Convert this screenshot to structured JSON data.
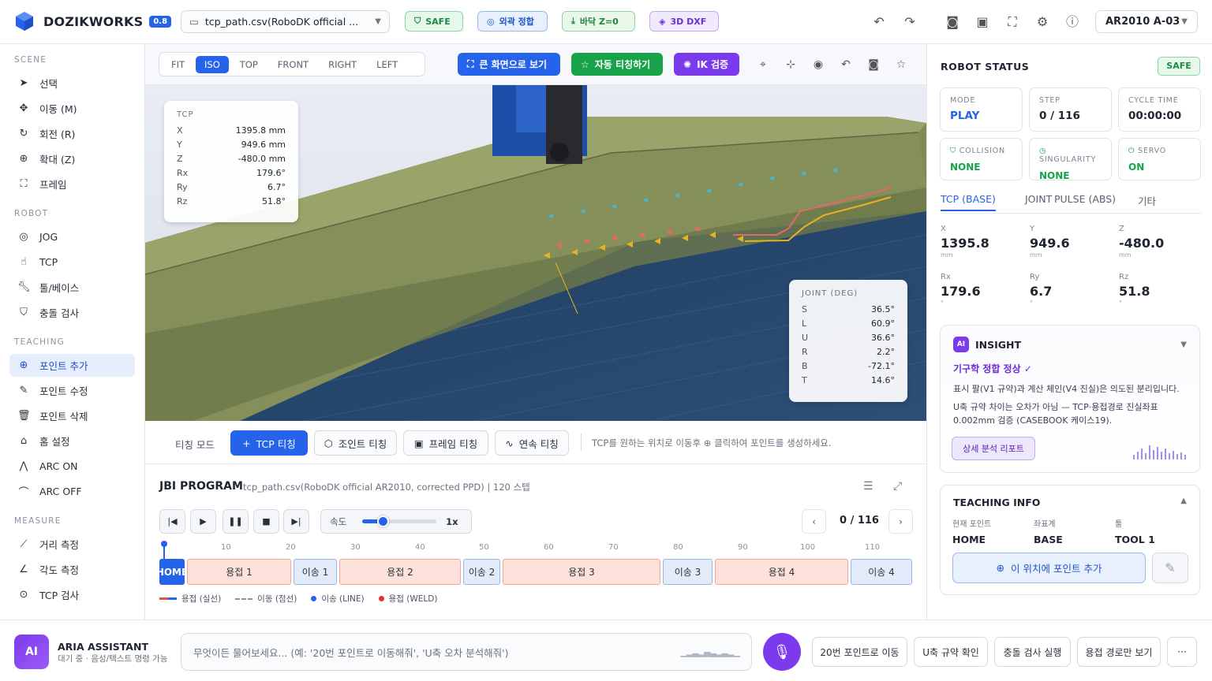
{
  "header": {
    "app_name": "DOZIKWORKS",
    "version": "0.8",
    "file": "tcp_path.csv(RoboDK official ...",
    "badges": {
      "safe": "SAFE",
      "ext": "외곽 정합",
      "floor": "바닥 Z=0",
      "dxf": "3D DXF"
    },
    "robot": "AR2010 A-03"
  },
  "sidebar": {
    "scene_title": "SCENE",
    "scene": [
      "선택",
      "이동 (M)",
      "회전 (R)",
      "확대 (Z)",
      "프레임"
    ],
    "robot_title": "ROBOT",
    "robot": [
      "JOG",
      "TCP",
      "툴/베이스",
      "충돌 검사"
    ],
    "teaching_title": "TEACHING",
    "teaching": [
      "포인트 추가",
      "포인트 수정",
      "포인트 삭제",
      "홈 설정",
      "ARC ON",
      "ARC OFF"
    ],
    "measure_title": "MEASURE",
    "measure": [
      "거리 측정",
      "각도 측정",
      "TCP 검사"
    ]
  },
  "viewbar": {
    "views": [
      "FIT",
      "ISO",
      "TOP",
      "FRONT",
      "RIGHT",
      "LEFT"
    ],
    "fullscreen": "큰 화면으로 보기",
    "auto_teach": "자동 티칭하기",
    "ik": "IK 검증"
  },
  "tcp_overlay": {
    "title": "TCP",
    "rows": [
      {
        "k": "X",
        "v": "1395.8 mm"
      },
      {
        "k": "Y",
        "v": "949.6 mm"
      },
      {
        "k": "Z",
        "v": "-480.0 mm"
      },
      {
        "k": "Rx",
        "v": "179.6°"
      },
      {
        "k": "Ry",
        "v": "6.7°"
      },
      {
        "k": "Rz",
        "v": "51.8°"
      }
    ]
  },
  "joint_overlay": {
    "title": "JOINT (DEG)",
    "rows": [
      {
        "k": "S",
        "v": "36.5°"
      },
      {
        "k": "L",
        "v": "60.9°"
      },
      {
        "k": "U",
        "v": "36.6°"
      },
      {
        "k": "R",
        "v": "2.2°"
      },
      {
        "k": "B",
        "v": "-72.1°"
      },
      {
        "k": "T",
        "v": "14.6°"
      }
    ]
  },
  "teach": {
    "label": "티칭 모드",
    "modes": [
      "TCP 티칭",
      "조인트 티칭",
      "프레임 티칭",
      "연속 티칭"
    ],
    "hint": "TCP를 원하는 위치로 이동후 ⊕ 클릭하여 포인트를 생성하세요."
  },
  "jbi": {
    "title": "JBI PROGRAM",
    "subtitle": "tcp_path.csv(RoboDK official AR2010, corrected PPD) | 120 스텝",
    "speed_label": "속도",
    "speed_value": "1x",
    "speed_fraction": 0.27,
    "counter": "0 / 116",
    "ticks": [
      "10",
      "20",
      "30",
      "40",
      "50",
      "60",
      "70",
      "80",
      "90",
      "100",
      "110"
    ],
    "segments": [
      {
        "label": "HOME",
        "type": "home"
      },
      {
        "label": "용접 1",
        "type": "weld"
      },
      {
        "label": "이송 1",
        "type": "move"
      },
      {
        "label": "용접 2",
        "type": "weld"
      },
      {
        "label": "이송 2",
        "type": "move"
      },
      {
        "label": "용접 3",
        "type": "weld"
      },
      {
        "label": "이송 3",
        "type": "move"
      },
      {
        "label": "용접 4",
        "type": "weld"
      },
      {
        "label": "이송 4",
        "type": "move"
      }
    ],
    "legend": [
      "용접 (실선)",
      "이동 (점선)",
      "이송 (LINE)",
      "용접 (WELD)"
    ]
  },
  "status": {
    "title": "ROBOT STATUS",
    "badge": "SAFE",
    "cards": [
      {
        "label": "MODE",
        "value": "PLAY"
      },
      {
        "label": "STEP",
        "value": "0 / 116"
      },
      {
        "label": "CYCLE TIME",
        "value": "00:00:00"
      },
      {
        "label": "COLLISION",
        "value": "NONE"
      },
      {
        "label": "SINGULARITY",
        "value": "NONE"
      },
      {
        "label": "SERVO",
        "value": "ON"
      }
    ],
    "tabs": [
      "TCP (BASE)",
      "JOINT",
      "PULSE (ABS)",
      "기타"
    ],
    "coords": [
      {
        "k": "X",
        "v": "1395.8",
        "u": "mm"
      },
      {
        "k": "Y",
        "v": "949.6",
        "u": "mm"
      },
      {
        "k": "Z",
        "v": "-480.0",
        "u": "mm"
      },
      {
        "k": "Rx",
        "v": "179.6",
        "u": "°"
      },
      {
        "k": "Ry",
        "v": "6.7",
        "u": "°"
      },
      {
        "k": "Rz",
        "v": "51.8",
        "u": "°"
      }
    ]
  },
  "insight": {
    "badge": "AI",
    "title": "INSIGHT",
    "ok": "기구학 정합 정상 ✓",
    "p1": "표시 팔(V1 규약)과 계산 체인(V4 진실)은 의도된 분리입니다.",
    "p2": "U축 규약 차이는 오차가 아님 — TCP·용접경로 진실좌표 0.002mm 검증 (CASEBOOK 케이스19).",
    "report": "상세 분석 리포트"
  },
  "teaching_info": {
    "title": "TEACHING INFO",
    "cols": [
      {
        "k": "현재 포인트",
        "v": "HOME"
      },
      {
        "k": "좌표계",
        "v": "BASE"
      },
      {
        "k": "툴",
        "v": "TOOL 1"
      }
    ],
    "add": "이 위치에 포인트 추가"
  },
  "assistant": {
    "avatar": "AI",
    "name": "ARIA ASSISTANT",
    "status": "대기 중 · 음성/텍스트 명령 가능",
    "placeholder": "무엇이든 물어보세요... (예: '20번 포인트로 이동해줘', 'U축 오차 분석해줘')",
    "quick": [
      "20번 포인트로 이동",
      "U축 규약 확인",
      "충돌 검사 실행",
      "용접 경로만 보기",
      "···"
    ]
  },
  "colors": {
    "accent": "#2563eb",
    "green": "#16a34a",
    "purple": "#7c3aed"
  }
}
